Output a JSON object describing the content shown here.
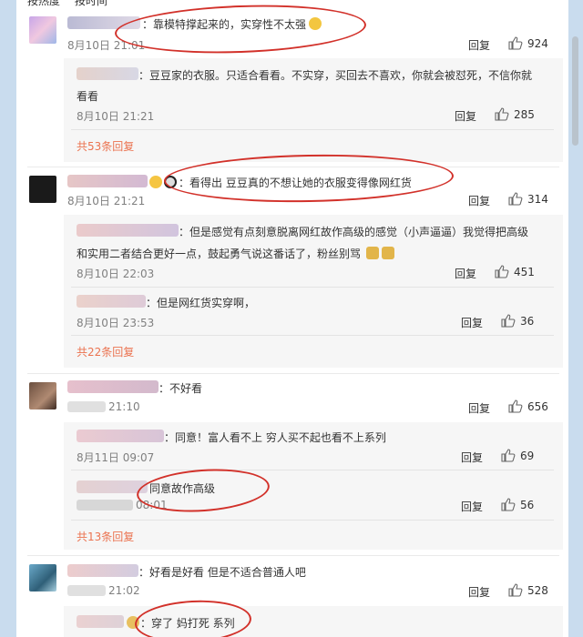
{
  "tabs": [
    "按热度",
    "按时间"
  ],
  "reply_label": "回复",
  "comments": [
    {
      "text": "：靠模特撑起来的，实穿性不太强",
      "time": "8月10日 21:01",
      "likes": "924",
      "replies": [
        {
          "text": "：豆豆家的衣服。只适合看看。不实穿，买回去不喜欢，你就会被怼死，不信你就",
          "text2": "看看",
          "time": "8月10日 21:21",
          "likes": "285"
        }
      ],
      "more": "共53条回复"
    },
    {
      "text": "：看得出 豆豆真的不想让她的衣服变得像网红货",
      "time": "8月10日 21:21",
      "likes": "314",
      "replies": [
        {
          "text": "：但是感觉有点刻意脱离网红故作高级的感觉（小声逼逼）我觉得把高级",
          "text2": "和实用二者结合更好一点，鼓起勇气说这番话了，粉丝别骂",
          "time": "8月10日 22:03",
          "likes": "451"
        },
        {
          "text": "：但是网红货实穿啊，",
          "time": "8月10日 23:53",
          "likes": "36"
        }
      ],
      "more": "共22条回复"
    },
    {
      "text": "：不好看",
      "time": "21:10",
      "likes": "656",
      "replies": [
        {
          "text": "：同意！富人看不上 穷人买不起也看不上系列",
          "time": "8月11日 09:07",
          "likes": "69"
        },
        {
          "text": "同意故作高级",
          "time": "08:01",
          "likes": "56"
        }
      ],
      "more": "共13条回复"
    },
    {
      "text": "：好看是好看 但是不适合普通人吧",
      "time": "21:02",
      "likes": "528",
      "replies": [
        {
          "text": "：穿了 妈打死 系列"
        }
      ]
    }
  ],
  "colors": {
    "accent": "#eb7350",
    "circle": "#d2312a",
    "background": "#c9dcee"
  }
}
